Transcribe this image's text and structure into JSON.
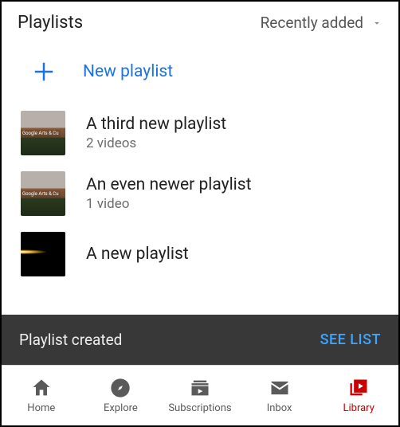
{
  "header": {
    "title": "Playlists",
    "sort_label": "Recently added"
  },
  "new_playlist": {
    "label": "New playlist"
  },
  "playlists": [
    {
      "title": "A third new playlist",
      "subtitle": "2 videos"
    },
    {
      "title": "An even newer playlist",
      "subtitle": "1 video"
    },
    {
      "title": "A new playlist",
      "subtitle": ""
    }
  ],
  "toast": {
    "message": "Playlist created",
    "action": "SEE LIST"
  },
  "nav": {
    "items": [
      {
        "label": "Home"
      },
      {
        "label": "Explore"
      },
      {
        "label": "Subscriptions"
      },
      {
        "label": "Inbox"
      },
      {
        "label": "Library"
      }
    ],
    "active_index": 4
  },
  "colors": {
    "accent_blue": "#1a73e8",
    "action_blue": "#3ea6ff",
    "active_red": "#cc0000",
    "toast_bg": "#383838"
  }
}
